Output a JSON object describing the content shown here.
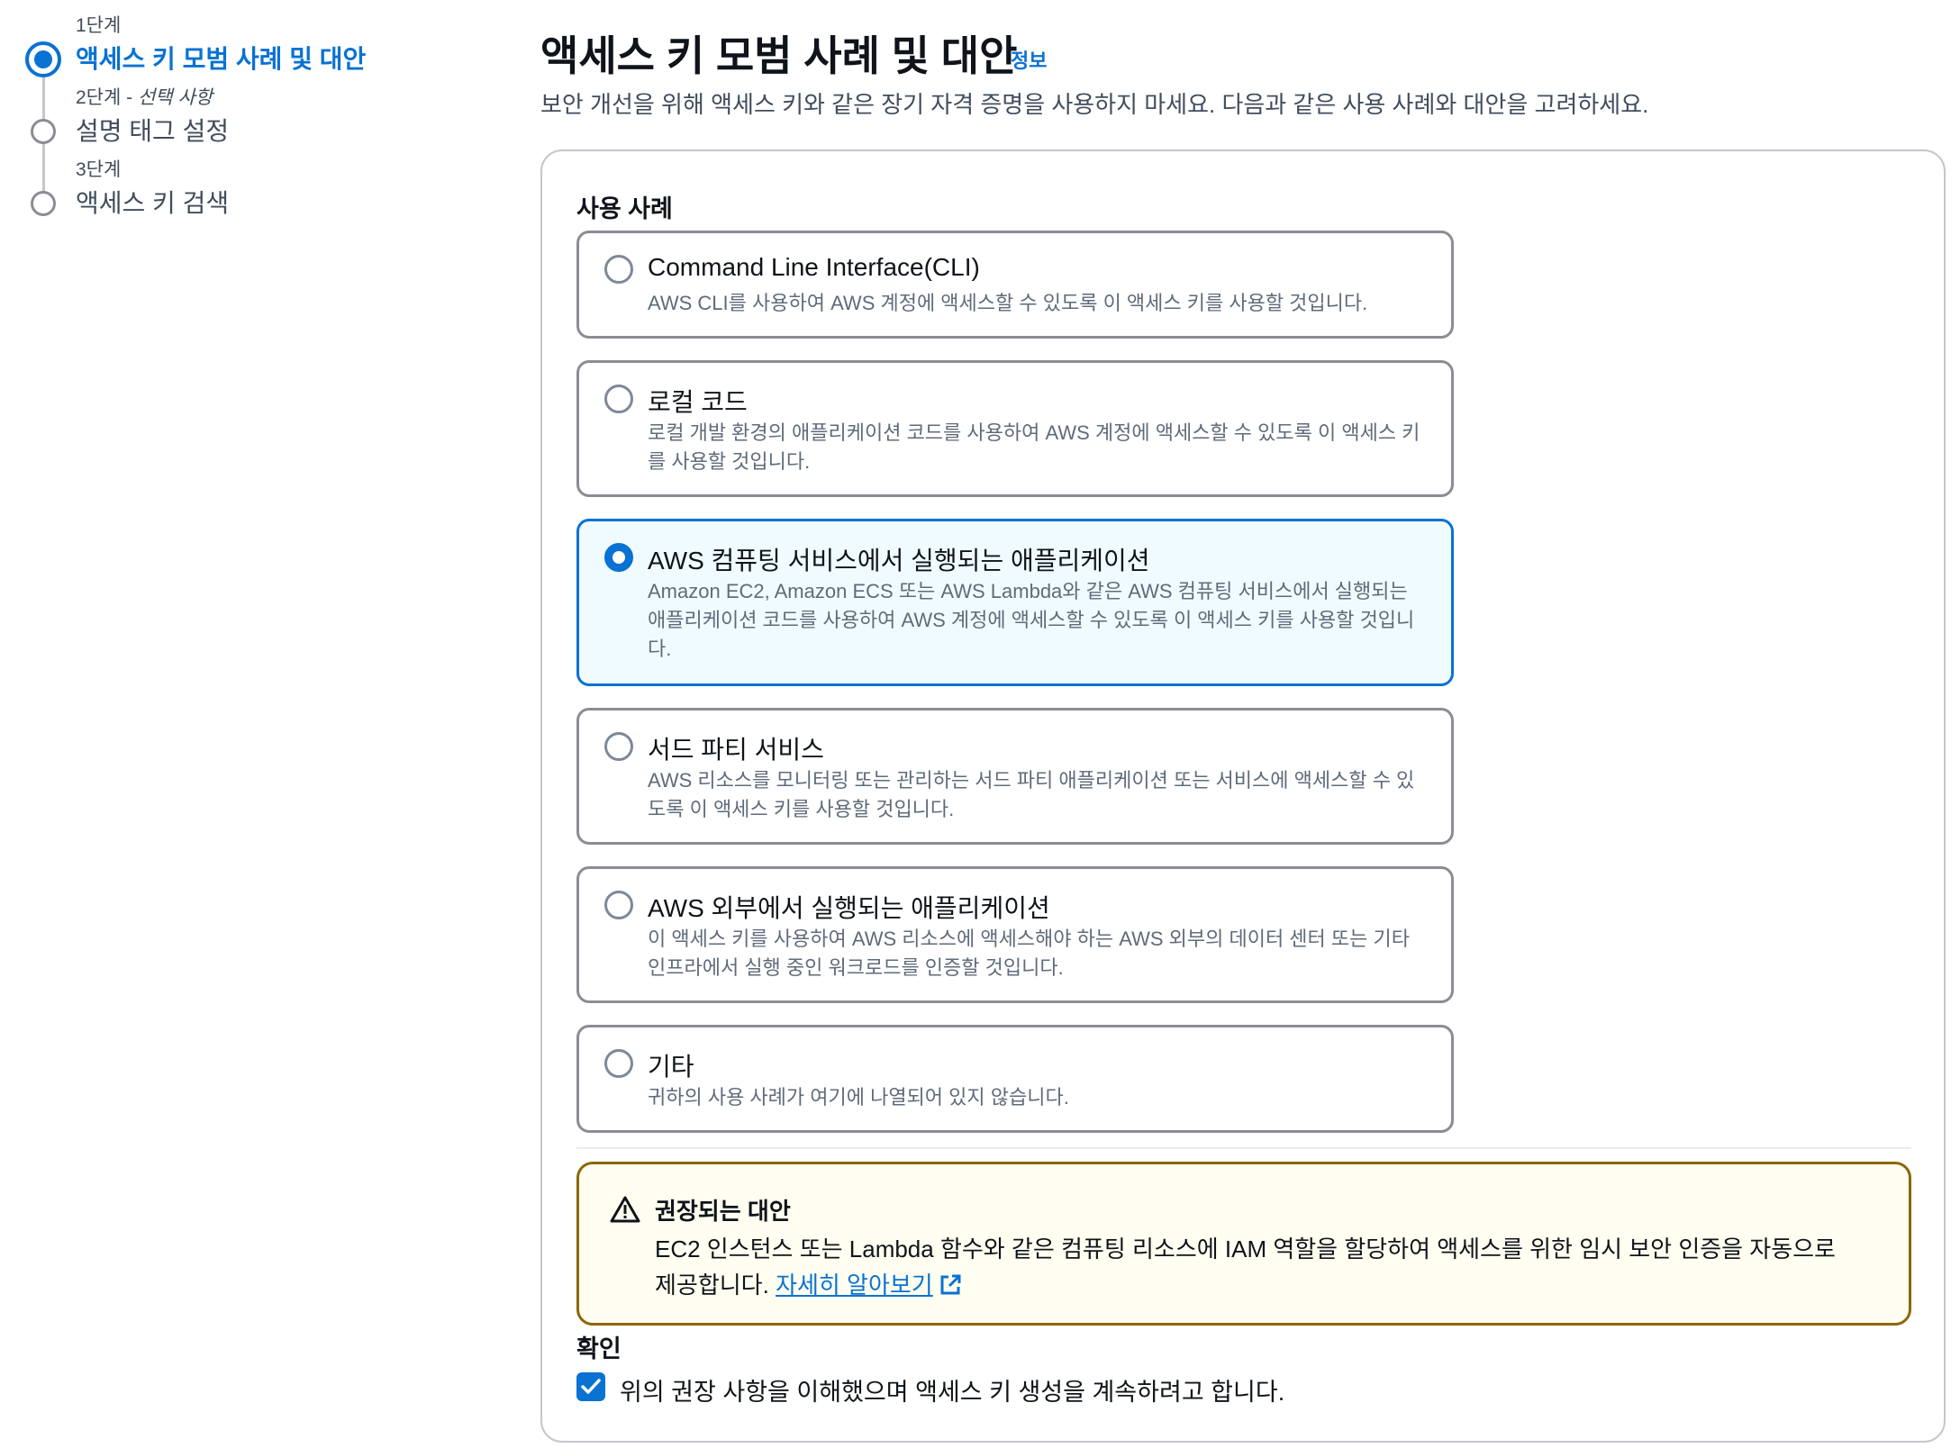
{
  "steps": [
    {
      "caption": "1단계",
      "optional": "",
      "title": "액세스 키 모범 사례 및 대안",
      "state": "active"
    },
    {
      "caption": "2단계 - ",
      "optional": "선택 사항",
      "title": "설명 태그 설정",
      "state": "inactive"
    },
    {
      "caption": "3단계",
      "optional": "",
      "title": "액세스 키 검색",
      "state": "inactive"
    }
  ],
  "header": {
    "title": "액세스 키 모범 사례 및 대안",
    "info_link": "정보",
    "description": "보안 개선을 위해 액세스 키와 같은 장기 자격 증명을 사용하지 마세요. 다음과 같은 사용 사례와 대안을 고려하세요."
  },
  "use_cases": {
    "label": "사용 사례",
    "selected_index": 2,
    "options": [
      {
        "title": "Command Line Interface(CLI)",
        "description": "AWS CLI를 사용하여 AWS 계정에 액세스할 수 있도록 이 액세스 키를 사용할 것입니다."
      },
      {
        "title": "로컬 코드",
        "description": "로컬 개발 환경의 애플리케이션 코드를 사용하여 AWS 계정에 액세스할 수 있도록 이 액세스 키를 사용할 것입니다."
      },
      {
        "title": "AWS 컴퓨팅 서비스에서 실행되는 애플리케이션",
        "description": "Amazon EC2, Amazon ECS 또는 AWS Lambda와 같은 AWS 컴퓨팅 서비스에서 실행되는 애플리케이션 코드를 사용하여 AWS 계정에 액세스할 수 있도록 이 액세스 키를 사용할 것입니다."
      },
      {
        "title": "서드 파티 서비스",
        "description": "AWS 리소스를 모니터링 또는 관리하는 서드 파티 애플리케이션 또는 서비스에 액세스할 수 있도록 이 액세스 키를 사용할 것입니다."
      },
      {
        "title": "AWS 외부에서 실행되는 애플리케이션",
        "description": "이 액세스 키를 사용하여 AWS 리소스에 액세스해야 하는 AWS 외부의 데이터 센터 또는 기타 인프라에서 실행 중인 워크로드를 인증할 것입니다."
      },
      {
        "title": "기타",
        "description": "귀하의 사용 사례가 여기에 나열되어 있지 않습니다."
      }
    ]
  },
  "alert": {
    "icon": "warning-icon",
    "title": "권장되는 대안",
    "body": "EC2 인스턴스 또는 Lambda 함수와 같은 컴퓨팅 리소스에 IAM 역할을 할당하여 액세스를 위한 임시 보안 인증을 자동으로 제공합니다. ",
    "link_text": "자세히 알아보기",
    "link_icon": "external-link-icon"
  },
  "confirmation": {
    "label": "확인",
    "checkbox_text": "위의 권장 사항을 이해했으며 액세스 키 생성을 계속하려고 합니다.",
    "checked": true
  },
  "colors": {
    "accent": "#0972d3",
    "warning_border": "#8d6605",
    "warning_bg": "#fffef0",
    "selected_bg": "#f0fbff"
  }
}
